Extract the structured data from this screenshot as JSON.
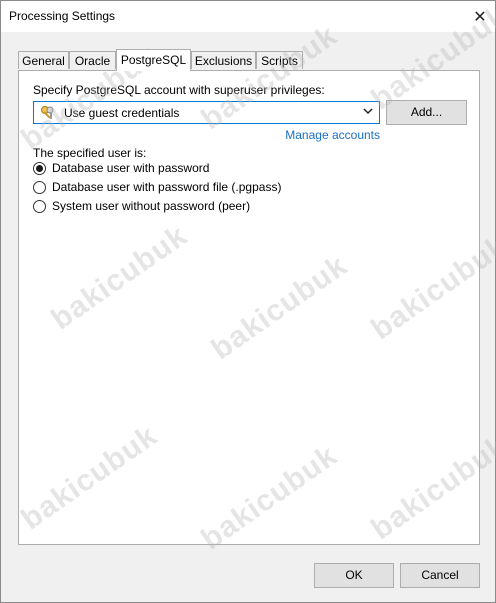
{
  "window": {
    "title": "Processing Settings",
    "close_glyph": "✕"
  },
  "tabs": [
    {
      "label": "General"
    },
    {
      "label": "Oracle"
    },
    {
      "label": "PostgreSQL",
      "active": true
    },
    {
      "label": "Exclusions"
    },
    {
      "label": "Scripts"
    }
  ],
  "postgresql": {
    "account_label": "Specify PostgreSQL account with superuser privileges:",
    "account_value": "Use guest credentials",
    "account_icon": "key-icon",
    "add_button": "Add...",
    "manage_link": "Manage accounts",
    "user_label": "The specified user is:",
    "options": [
      {
        "label": "Database user with password",
        "checked": true
      },
      {
        "label": "Database user with password file (.pgpass)",
        "checked": false
      },
      {
        "label": "System user without password (peer)",
        "checked": false
      }
    ]
  },
  "footer": {
    "ok": "OK",
    "cancel": "Cancel"
  },
  "watermark": "bakicubuk",
  "colors": {
    "accent": "#0078d7",
    "link": "#1a6fc4"
  }
}
